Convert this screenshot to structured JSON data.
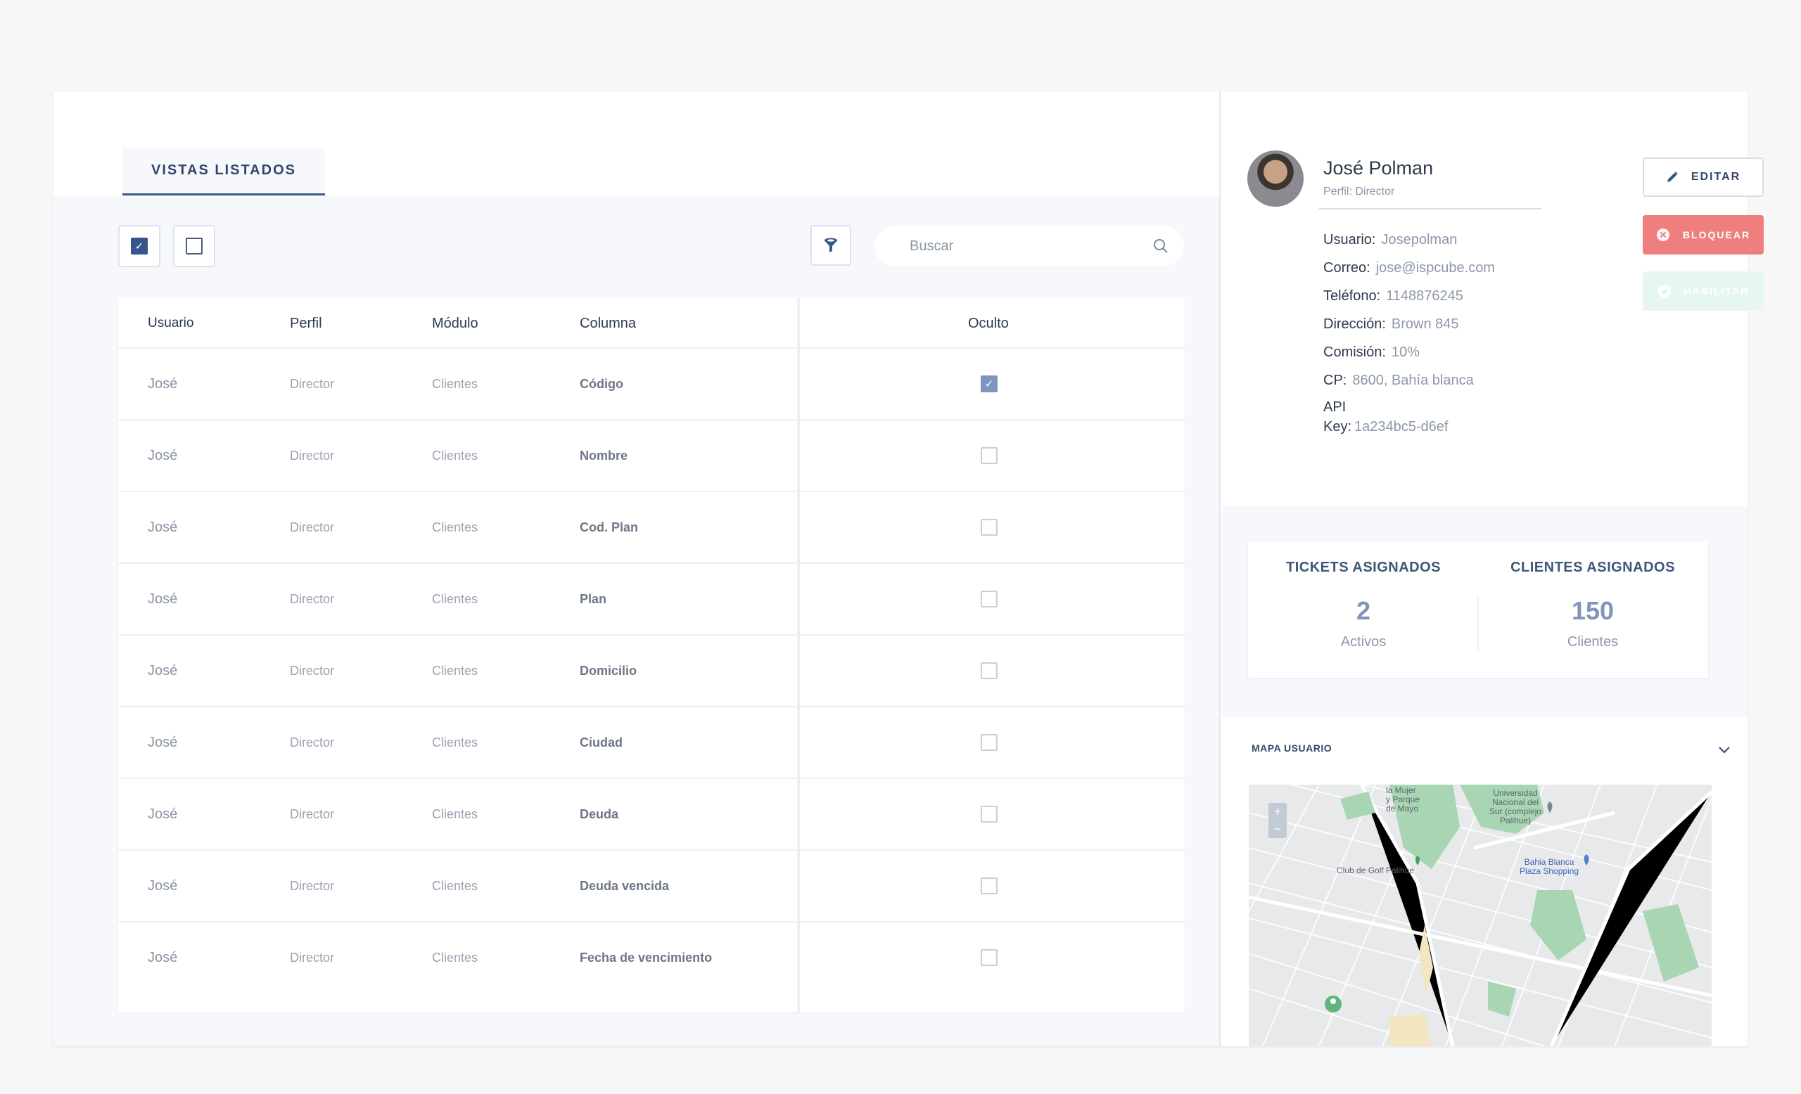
{
  "tab": {
    "label": "VISTAS LISTADOS"
  },
  "search": {
    "placeholder": "Buscar"
  },
  "table": {
    "headers": {
      "usuario": "Usuario",
      "perfil": "Perfil",
      "modulo": "Módulo",
      "columna": "Columna",
      "oculto": "Oculto"
    },
    "rows": [
      {
        "usuario": "José",
        "perfil": "Director",
        "modulo": "Clientes",
        "columna": "Código",
        "oculto": true
      },
      {
        "usuario": "José",
        "perfil": "Director",
        "modulo": "Clientes",
        "columna": "Nombre",
        "oculto": false
      },
      {
        "usuario": "José",
        "perfil": "Director",
        "modulo": "Clientes",
        "columna": "Cod. Plan",
        "oculto": false
      },
      {
        "usuario": "José",
        "perfil": "Director",
        "modulo": "Clientes",
        "columna": "Plan",
        "oculto": false
      },
      {
        "usuario": "José",
        "perfil": "Director",
        "modulo": "Clientes",
        "columna": "Domicilio",
        "oculto": false
      },
      {
        "usuario": "José",
        "perfil": "Director",
        "modulo": "Clientes",
        "columna": "Ciudad",
        "oculto": false
      },
      {
        "usuario": "José",
        "perfil": "Director",
        "modulo": "Clientes",
        "columna": "Deuda",
        "oculto": false
      },
      {
        "usuario": "José",
        "perfil": "Director",
        "modulo": "Clientes",
        "columna": "Deuda vencida",
        "oculto": false
      },
      {
        "usuario": "José",
        "perfil": "Director",
        "modulo": "Clientes",
        "columna": "Fecha de vencimiento",
        "oculto": false
      }
    ]
  },
  "profile": {
    "name": "José Polman",
    "perfil": "Perfil: Director",
    "fields": [
      {
        "label": "Usuario:",
        "value": "Josepolman"
      },
      {
        "label": "Correo:",
        "value": "jose@ispcube.com"
      },
      {
        "label": "Teléfono:",
        "value": "1148876245"
      },
      {
        "label": "Dirección:",
        "value": "Brown 845"
      },
      {
        "label": "Comisión:",
        "value": "10%"
      },
      {
        "label": "CP:",
        "value": "8600, Bahía blanca"
      }
    ],
    "api_label_1": "API",
    "api_label_2": "Key:",
    "api_value": "1a234bc5-d6ef"
  },
  "actions": {
    "edit": "EDITAR",
    "block": "BLOQUEAR",
    "enable": "HABILITAR"
  },
  "stats": {
    "tickets": {
      "label": "TICKETS ASIGNADOS",
      "value": "2",
      "sub": "Activos"
    },
    "clientes": {
      "label": "CLIENTES ASIGNADOS",
      "value": "150",
      "sub": "Clientes"
    }
  },
  "map": {
    "title": "MAPA USUARIO",
    "zoom_in": "+",
    "zoom_out": "−",
    "labels": {
      "mujer": "la Mujer\ny Parque\nde Mayo",
      "universidad": "Universidad\nNacional del\nSur (complejo\nPalihue)",
      "golf": "Club de Golf Palihue",
      "plaza": "Bahia Blanca\nPlaza Shopping"
    }
  },
  "colors": {
    "accent": "#34568a",
    "block": "#ef7f7f",
    "enable": "#e6f7f0",
    "bg": "#f6f8fc"
  }
}
